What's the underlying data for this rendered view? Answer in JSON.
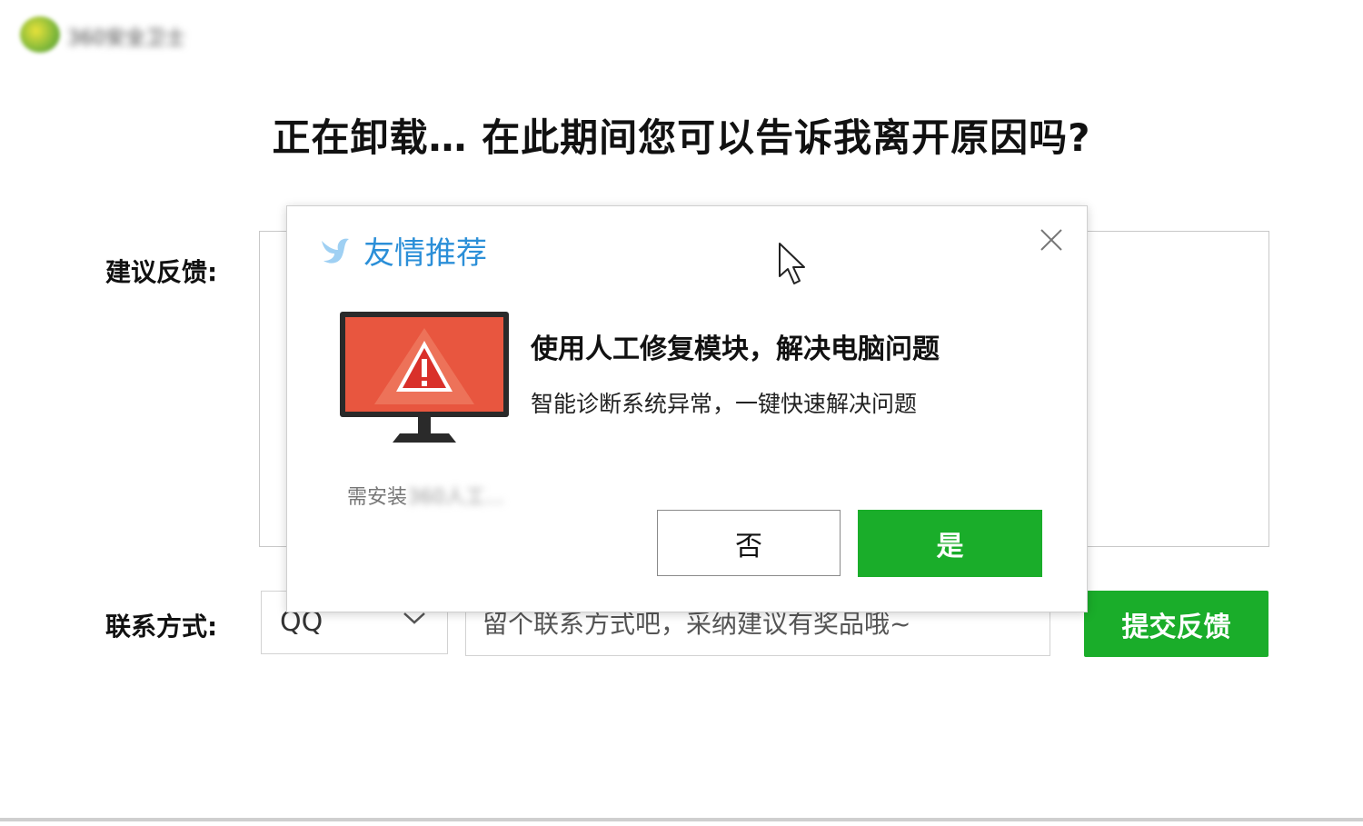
{
  "app": {
    "title": "360安全卫士",
    "accent": "#1aad2a"
  },
  "headline": "正在卸载… 在此期间您可以告诉我离开原因吗?",
  "form": {
    "suggest_label": "建议反馈:",
    "contact_label": "联系方式:",
    "contact_type": "QQ",
    "contact_placeholder": "留个联系方式吧，采纳建议有奖品哦~",
    "submit_label": "提交反馈"
  },
  "modal": {
    "title": "友情推荐",
    "title_color": "#2b8fd8",
    "headline": "使用人工修复模块，解决电脑问题",
    "subline": "智能诊断系统异常，一键快速解决问题",
    "need_install_prefix": "需安装",
    "need_install_blurred": "360人工...",
    "no_label": "否",
    "yes_label": "是"
  }
}
